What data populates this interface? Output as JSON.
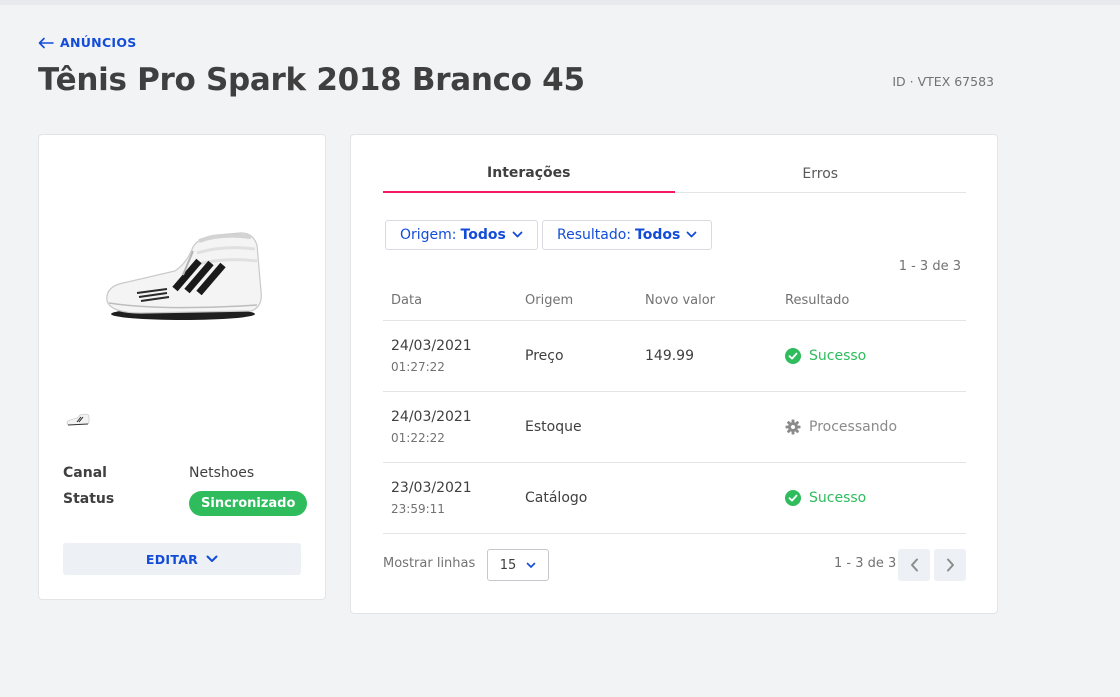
{
  "header": {
    "back_label": "ANÚNCIOS",
    "title": "Tênis Pro Spark 2018 Branco 45",
    "id_text": "ID · VTEX 67583"
  },
  "product": {
    "canal_label": "Canal",
    "canal_value": "Netshoes",
    "status_label": "Status",
    "status_value": "Sincronizado",
    "edit_label": "EDITAR"
  },
  "tabs": [
    {
      "label": "Interações",
      "active": true
    },
    {
      "label": "Erros",
      "active": false
    }
  ],
  "filters": {
    "origin_prefix": "Origem:",
    "origin_value": "Todos",
    "result_prefix": "Resultado:",
    "result_value": "Todos"
  },
  "table": {
    "count_text": "1 - 3 de 3",
    "columns": [
      "Data",
      "Origem",
      "Novo valor",
      "Resultado"
    ],
    "rows": [
      {
        "date": "24/03/2021",
        "time": "01:27:22",
        "origin": "Preço",
        "new_value": "149.99",
        "result": "Sucesso",
        "status": "success"
      },
      {
        "date": "24/03/2021",
        "time": "01:22:22",
        "origin": "Estoque",
        "new_value": "",
        "result": "Processando",
        "status": "processing"
      },
      {
        "date": "23/03/2021",
        "time": "23:59:11",
        "origin": "Catálogo",
        "new_value": "",
        "result": "Sucesso",
        "status": "success"
      }
    ]
  },
  "pagination": {
    "rows_label": "Mostrar linhas",
    "rows_value": "15",
    "count_text": "1 - 3 de 3"
  },
  "colors": {
    "primary": "#134cd8",
    "accent": "#f71963",
    "success": "#2ebc5d",
    "muted": "#727273"
  },
  "icons": {
    "back": "arrow-left-icon",
    "caret": "chevron-down-icon",
    "success": "check-circle-icon",
    "processing": "gear-icon",
    "prev": "chevron-left-icon",
    "next": "chevron-right-icon"
  }
}
